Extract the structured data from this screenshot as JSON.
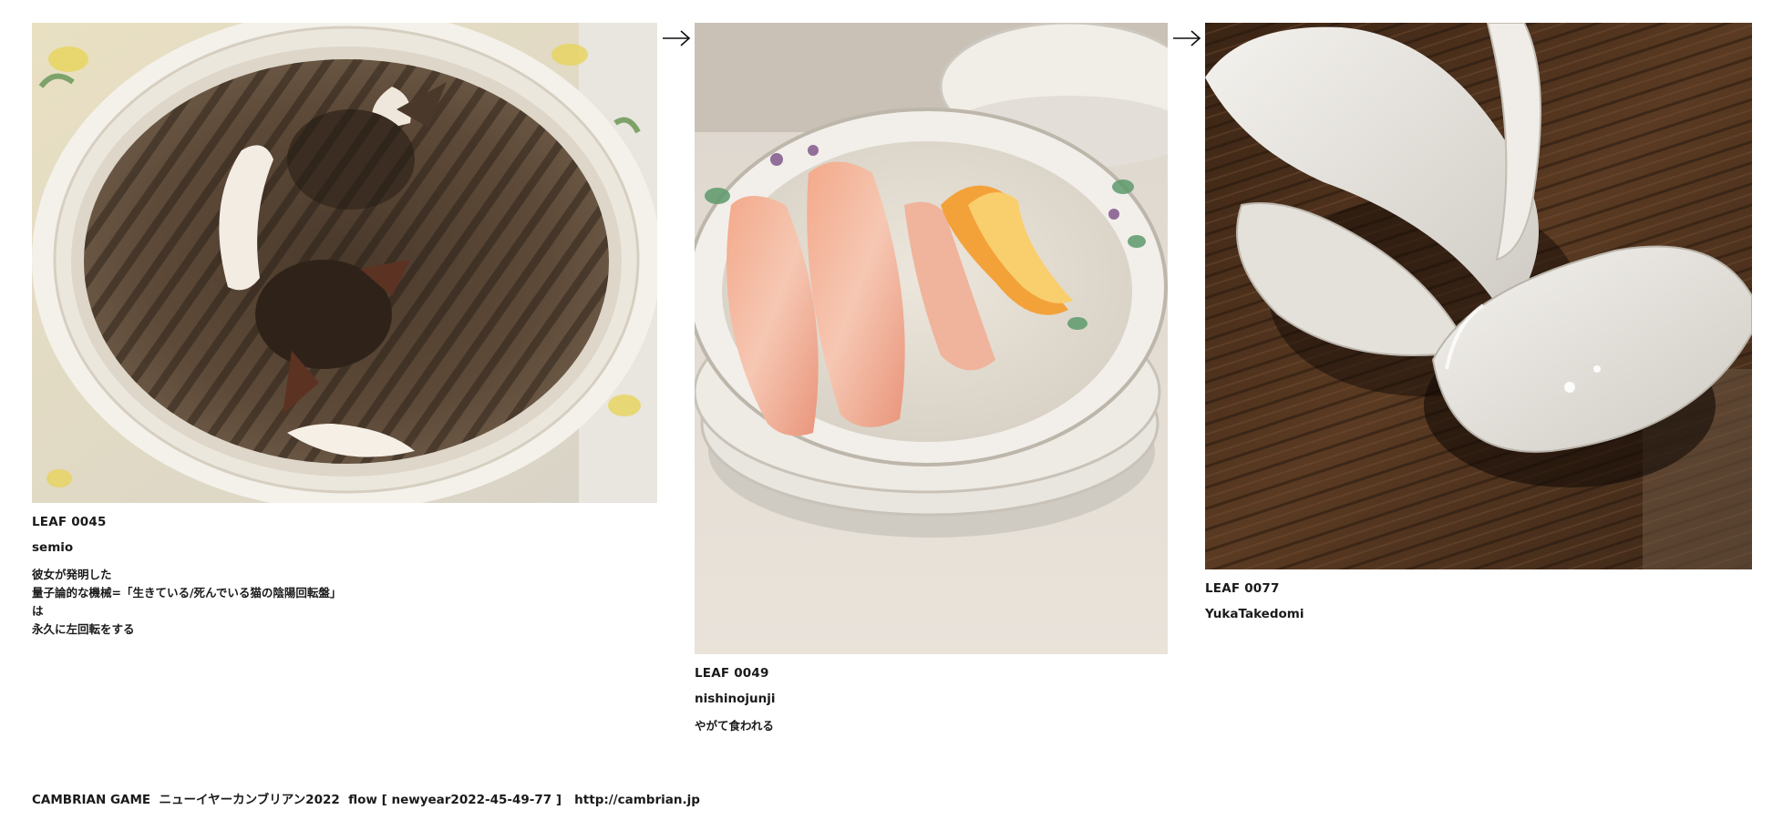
{
  "leaves": [
    {
      "id_label": "LEAF 0045",
      "author": "semio",
      "caption": "彼女が発明した\n量子論的な機械=「生きている/死んでいる猫の陰陽回転盤」は\n永久に左回転をする",
      "image": "tabby-cats-curled-in-round-bed"
    },
    {
      "id_label": "LEAF 0049",
      "author": "nishinojunji",
      "caption": "やがて食われる",
      "image": "grapefruit-and-orange-peels-in-stacked-bowls"
    },
    {
      "id_label": "LEAF 0077",
      "author": "YukaTakedomi",
      "caption": "",
      "image": "broken-white-porcelain-bowl-on-wooden-table"
    }
  ],
  "arrows": [
    "right-arrow-icon",
    "right-arrow-icon"
  ],
  "footer": {
    "game": "CAMBRIAN GAME  ニューイヤーカンブリアン2022  flow [ newyear2022-45-49-77 ]",
    "url": "http://cambrian.jp"
  },
  "colors": {
    "text": "#1a1a1a",
    "background": "#ffffff"
  }
}
